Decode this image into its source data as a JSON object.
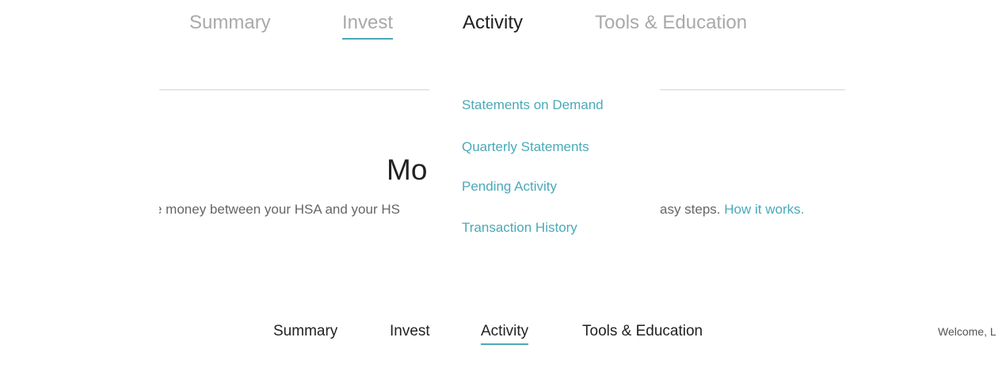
{
  "top_nav": {
    "tabs": [
      "Summary",
      "Invest",
      "Activity",
      "Tools & Education"
    ]
  },
  "dropdown": {
    "items": [
      "Statements on Demand",
      "Quarterly Statements",
      "Pending Activity",
      "Transaction History"
    ]
  },
  "content": {
    "title_fragment": "Mo",
    "body_left_fragment": "e money between your HSA and your HS",
    "body_right_fragment": "asy steps. ",
    "link_text": "How it works."
  },
  "bottom_nav": {
    "tabs": [
      "Summary",
      "Invest",
      "Activity",
      "Tools & Education"
    ],
    "welcome_fragment": "Welcome, L"
  },
  "colors": {
    "accent": "#4aa9b8",
    "inactive_tab": "#a9a9a9",
    "active_text": "#222222",
    "body_text": "#666666"
  }
}
